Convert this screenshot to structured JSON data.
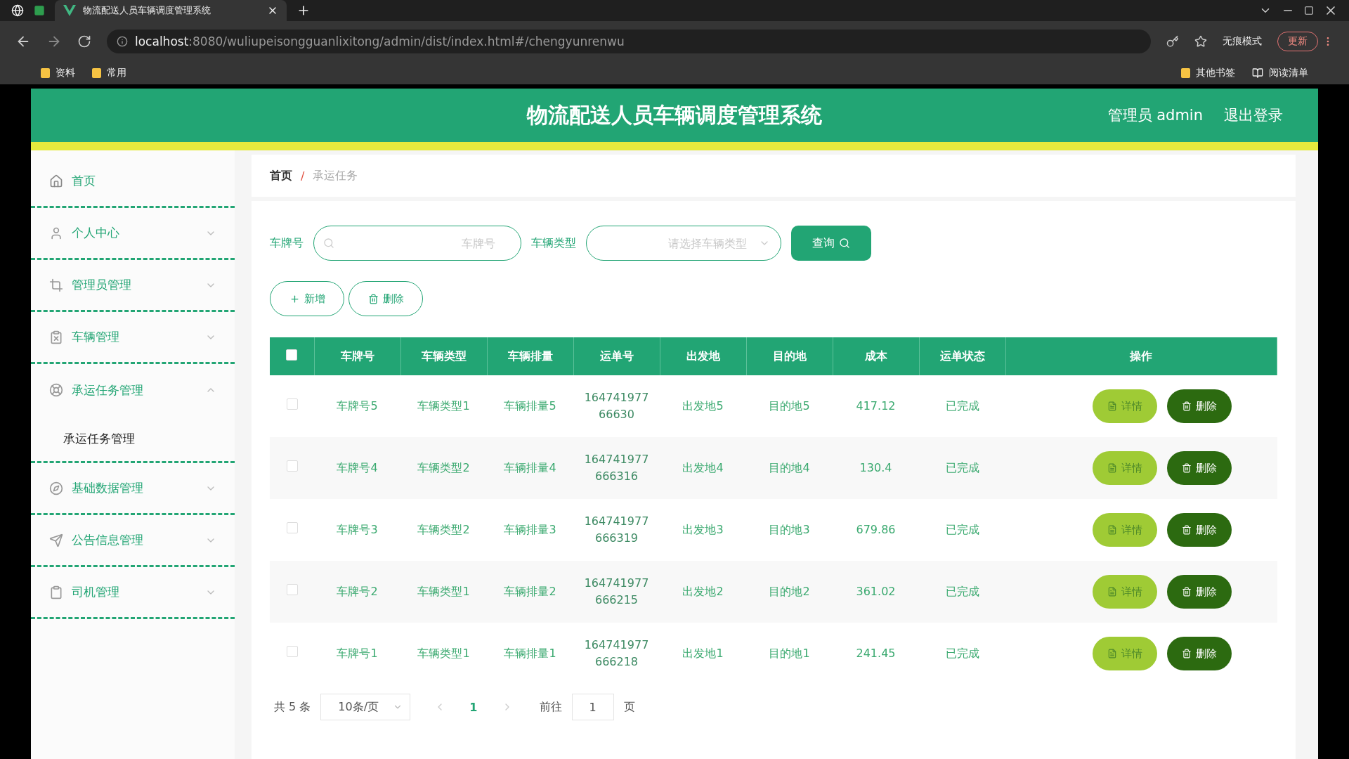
{
  "browser": {
    "tabs": [
      {
        "title": "物流配送人员车辆调度管理系统",
        "selected": true
      }
    ],
    "url_host": "localhost",
    "url_rest": ":8080/wuliupeisongguanlixitong/admin/dist/index.html#/chengyunrenwu",
    "mode_label": "无痕模式",
    "update_button": "更新",
    "bookmarks": [
      "资料",
      "常用"
    ],
    "right_bookmarks": [
      "其他书签",
      "阅读清单"
    ]
  },
  "header": {
    "title": "物流配送人员车辆调度管理系统",
    "user": "管理员 admin",
    "logout": "退出登录"
  },
  "sidebar": {
    "items": [
      {
        "label": "首页",
        "kind": "link"
      },
      {
        "label": "个人中心",
        "kind": "menu",
        "expanded": false
      },
      {
        "label": "管理员管理",
        "kind": "menu",
        "expanded": false
      },
      {
        "label": "车辆管理",
        "kind": "menu",
        "expanded": false
      },
      {
        "label": "承运任务管理",
        "kind": "menu",
        "expanded": true,
        "children": [
          {
            "label": "承运任务管理",
            "selected": true
          }
        ]
      },
      {
        "label": "基础数据管理",
        "kind": "menu",
        "expanded": false
      },
      {
        "label": "公告信息管理",
        "kind": "menu",
        "expanded": false
      },
      {
        "label": "司机管理",
        "kind": "menu",
        "expanded": false
      }
    ]
  },
  "breadcrumb": {
    "items": [
      "首页",
      "承运任务"
    ],
    "separator": "/"
  },
  "search": {
    "fields": [
      {
        "label": "车牌号",
        "kind": "text",
        "placeholder": "车牌号"
      },
      {
        "label": "车辆类型",
        "kind": "select",
        "placeholder": "请选择车辆类型"
      }
    ],
    "button": "查询"
  },
  "actions": [
    {
      "label": "新增",
      "kind": "add"
    },
    {
      "label": "删除",
      "kind": "delete"
    }
  ],
  "table": {
    "header_checkbox": {
      "checked": false
    },
    "columns": [
      "车牌号",
      "车辆类型",
      "车辆排量",
      "运单号",
      "出发地",
      "目的地",
      "成本",
      "运单状态",
      "操作"
    ],
    "rows": [
      {
        "selected": false,
        "cells": [
          "车牌号5",
          "车辆类型1",
          "车辆排量5",
          "16474197766630",
          "出发地5",
          "目的地5",
          "417.12",
          "已完成"
        ],
        "actions": [
          {
            "label": "详情",
            "kind": "detail"
          },
          {
            "label": "删除",
            "kind": "delete"
          }
        ]
      },
      {
        "selected": false,
        "cells": [
          "车牌号4",
          "车辆类型2",
          "车辆排量4",
          "164741977666316",
          "出发地4",
          "目的地4",
          "130.4",
          "已完成"
        ],
        "actions": [
          {
            "label": "详情",
            "kind": "detail"
          },
          {
            "label": "删除",
            "kind": "delete"
          }
        ]
      },
      {
        "selected": false,
        "cells": [
          "车牌号3",
          "车辆类型2",
          "车辆排量3",
          "164741977666319",
          "出发地3",
          "目的地3",
          "679.86",
          "已完成"
        ],
        "actions": [
          {
            "label": "详情",
            "kind": "detail"
          },
          {
            "label": "删除",
            "kind": "delete"
          }
        ]
      },
      {
        "selected": false,
        "cells": [
          "车牌号2",
          "车辆类型1",
          "车辆排量2",
          "164741977666215",
          "出发地2",
          "目的地2",
          "361.02",
          "已完成"
        ],
        "actions": [
          {
            "label": "详情",
            "kind": "detail"
          },
          {
            "label": "删除",
            "kind": "delete"
          }
        ]
      },
      {
        "selected": false,
        "cells": [
          "车牌号1",
          "车辆类型1",
          "车辆排量1",
          "164741977666218",
          "出发地1",
          "目的地1",
          "241.45",
          "已完成"
        ],
        "actions": [
          {
            "label": "详情",
            "kind": "detail"
          },
          {
            "label": "删除",
            "kind": "delete"
          }
        ]
      }
    ]
  },
  "pagination": {
    "total": "共 5 条",
    "page_size": "10条/页",
    "pages": [
      {
        "label": "1",
        "selected": true
      }
    ],
    "goto_label": "前往",
    "goto_value": "1",
    "page_suffix": "页"
  }
}
